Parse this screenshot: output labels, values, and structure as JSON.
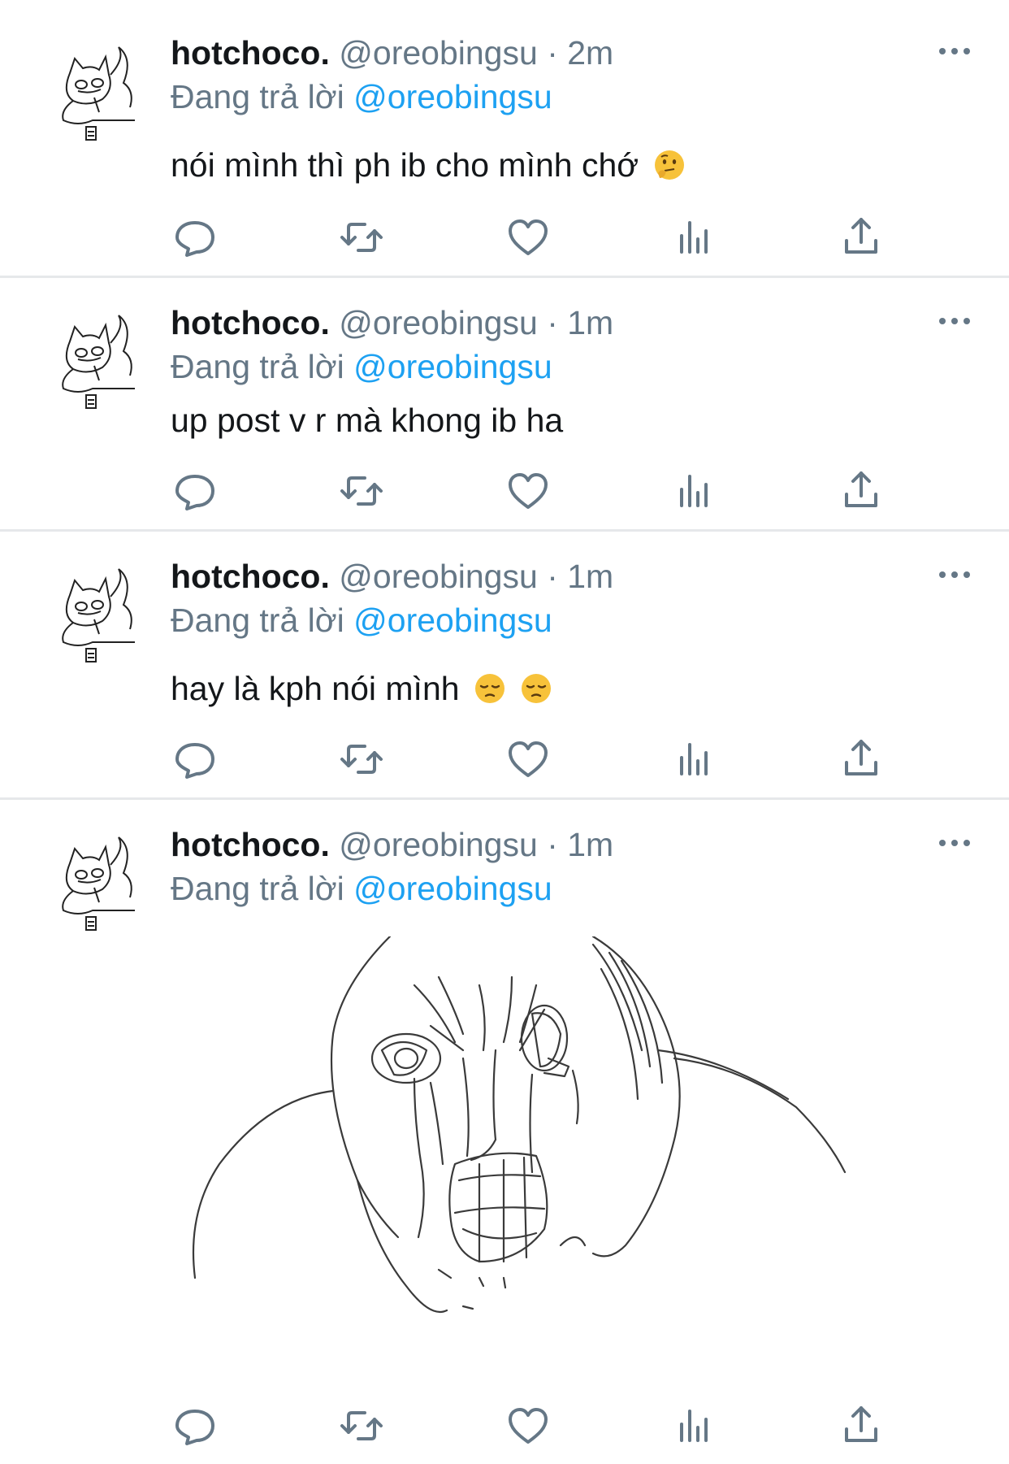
{
  "tweets": [
    {
      "name": "hotchoco.",
      "handle": "@oreobingsu",
      "separator": "·",
      "time": "2m",
      "reply_prefix": "Đang trả lời",
      "reply_to": "@oreobingsu",
      "text": "nói mình thì ph ib cho mình chớ",
      "emojis": [
        "thinking-face"
      ]
    },
    {
      "name": "hotchoco.",
      "handle": "@oreobingsu",
      "separator": "·",
      "time": "1m",
      "reply_prefix": "Đang trả lời",
      "reply_to": "@oreobingsu",
      "text": "up post v r mà khong ib ha",
      "emojis": []
    },
    {
      "name": "hotchoco.",
      "handle": "@oreobingsu",
      "separator": "·",
      "time": "1m",
      "reply_prefix": "Đang trả lời",
      "reply_to": "@oreobingsu",
      "text": "hay là kph nói mình",
      "emojis": [
        "pensive-face",
        "pensive-face"
      ]
    },
    {
      "name": "hotchoco.",
      "handle": "@oreobingsu",
      "separator": "·",
      "time": "1m",
      "reply_prefix": "Đang trả lời",
      "reply_to": "@oreobingsu",
      "text": "",
      "media": "crying-face-sketch"
    }
  ],
  "colors": {
    "text": "#14171a",
    "secondary": "#657786",
    "accent": "#1da1f2",
    "divider": "#e6e8ea",
    "emoji_yellow": "#f7c23a"
  },
  "icons": [
    "reply-icon",
    "retweet-icon",
    "like-icon",
    "analytics-icon",
    "share-icon",
    "more-icon"
  ]
}
